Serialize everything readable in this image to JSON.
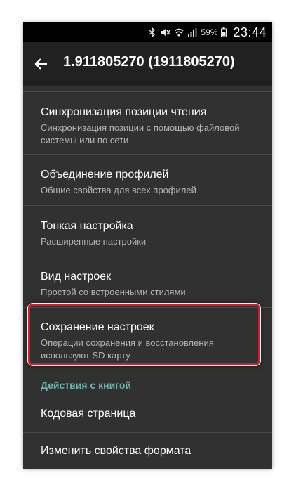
{
  "status_bar": {
    "battery_percent": "59%",
    "time": "23:44",
    "icons": [
      "bluetooth-icon",
      "mute-icon",
      "wifi-icon",
      "signal-icon",
      "battery-icon"
    ]
  },
  "toolbar": {
    "back_icon": "arrow-left-icon",
    "title": "1.911805270 (1911805270)"
  },
  "settings": {
    "items": [
      {
        "title": "Синхронизация позиции чтения",
        "subtitle_lines": [
          "Синхронизация позиции с помощью файловой",
          "системы или по сети"
        ]
      },
      {
        "title": "Объединение профилей",
        "subtitle": "Общие свойства для всех профилей"
      },
      {
        "title": "Тонкая настройка",
        "subtitle": "Расширенные настройки"
      },
      {
        "title": "Вид настроек",
        "subtitle": "Простой со встроенными стилями"
      },
      {
        "title": "Сохранение настроек",
        "subtitle_lines": [
          "Операции сохранения и восстановления",
          "используют SD карту"
        ]
      }
    ],
    "section_header": "Действия с книгой",
    "book_items": [
      {
        "title": "Кодовая страница"
      },
      {
        "title": "Изменить свойства формата"
      }
    ]
  },
  "colors": {
    "background": "#313131",
    "toolbar": "#212121",
    "section_accent": "#6fb5ad",
    "highlight_border": "#d21c2b"
  }
}
